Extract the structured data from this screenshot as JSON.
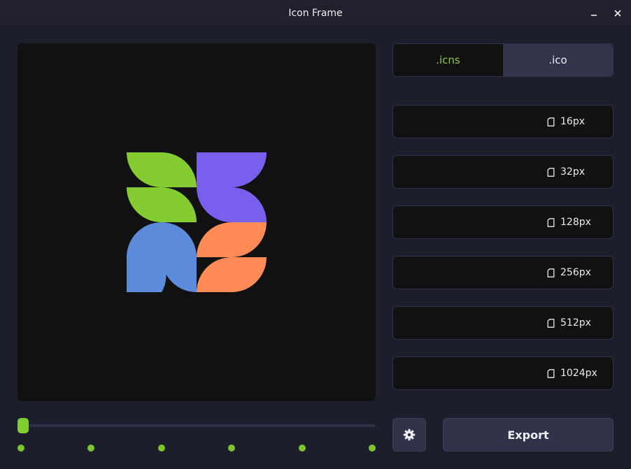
{
  "window": {
    "title": "Icon Frame",
    "minimize_symbol": "—",
    "close_symbol": "✕"
  },
  "preview": {
    "icon": "app-logo-four-petals",
    "colors": {
      "background": "#111112",
      "green": "#85cc33",
      "purple": "#7a5fef",
      "blue": "#5d8bdc",
      "orange": "#ff8c57"
    }
  },
  "format_tabs": [
    {
      "label": ".icns",
      "active": false
    },
    {
      "label": ".ico",
      "active": true
    }
  ],
  "sizes": [
    {
      "label": "16px",
      "icon": "file-icon"
    },
    {
      "label": "32px",
      "icon": "file-icon"
    },
    {
      "label": "128px",
      "icon": "file-icon"
    },
    {
      "label": "256px",
      "icon": "file-icon"
    },
    {
      "label": "512px",
      "icon": "file-icon"
    },
    {
      "label": "1024px",
      "icon": "file-icon"
    }
  ],
  "slider": {
    "value": 0,
    "steps": 6
  },
  "settings_icon": "gear-icon",
  "export_label": "Export",
  "accent_color": "#84cc34"
}
